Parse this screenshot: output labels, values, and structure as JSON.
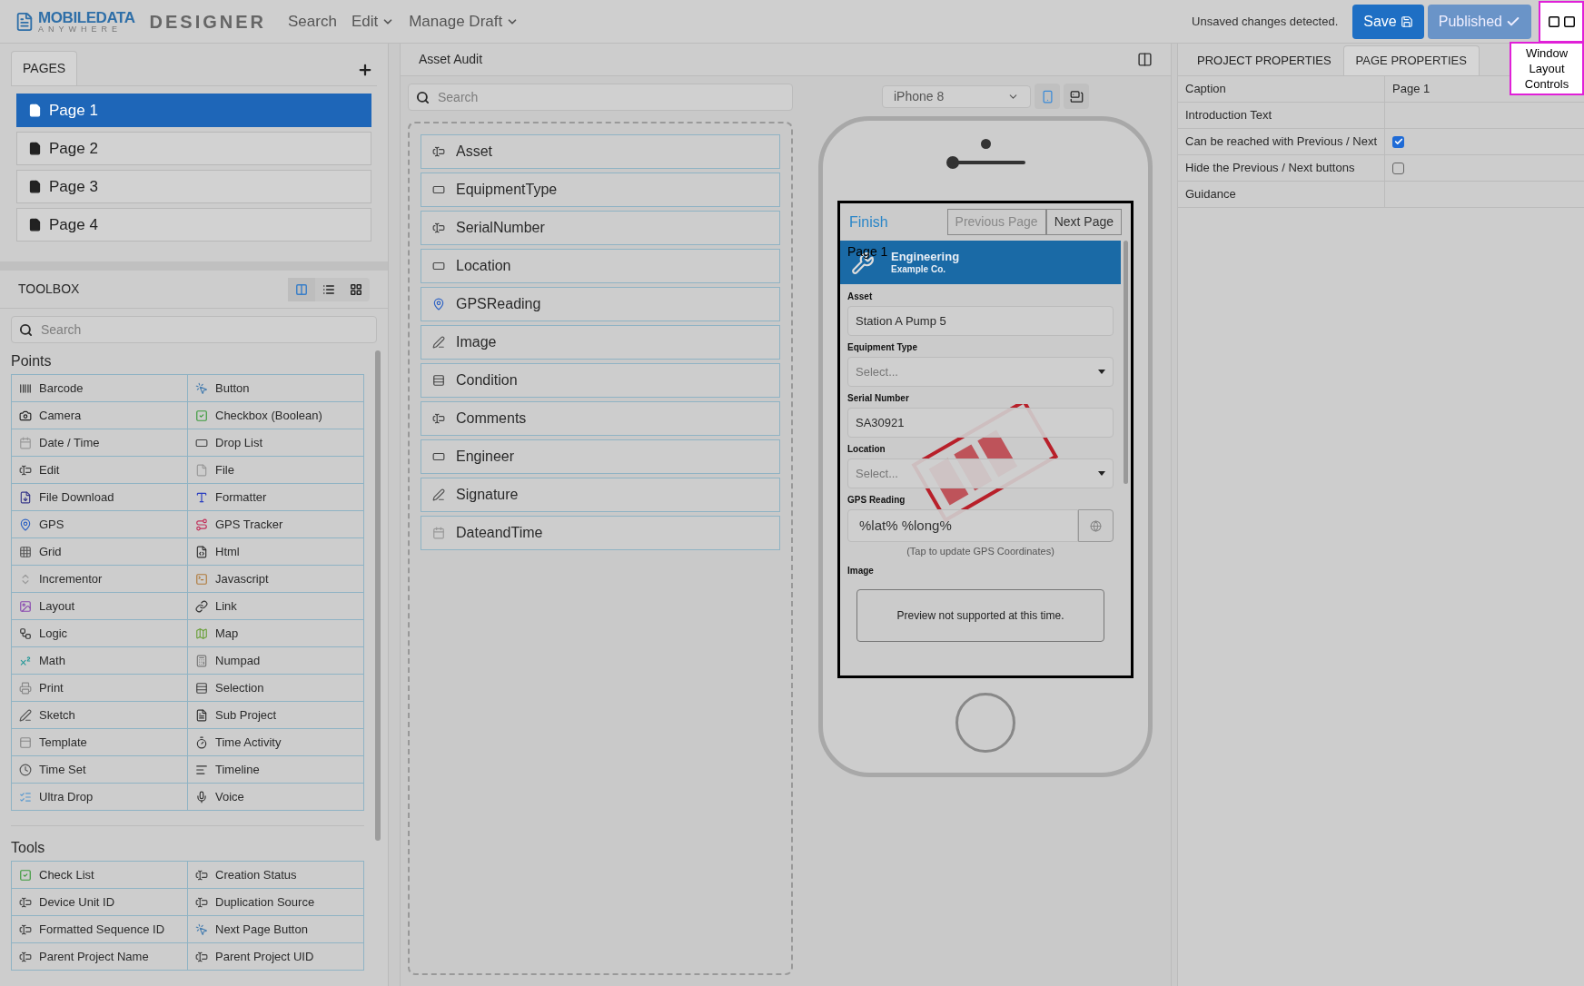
{
  "app": {
    "logo_top": "MOBILEDATA",
    "logo_bottom": "ANYWHERE",
    "title": "DESIGNER"
  },
  "menu": [
    {
      "label": "Search",
      "dropdown": false
    },
    {
      "label": "Edit",
      "dropdown": true
    },
    {
      "label": "Manage Draft",
      "dropdown": true
    }
  ],
  "status": "Unsaved changes detected.",
  "save_button": "Save",
  "publish_button": "Published",
  "layout_tooltip": "Window Layout Controls",
  "pages": {
    "tab": "PAGES",
    "items": [
      {
        "label": "Page 1",
        "selected": true
      },
      {
        "label": "Page 2",
        "selected": false
      },
      {
        "label": "Page 3",
        "selected": false
      },
      {
        "label": "Page 4",
        "selected": false
      }
    ]
  },
  "toolbox": {
    "title": "TOOLBOX",
    "views": [
      {
        "kind": "columns",
        "selected": true
      },
      {
        "kind": "list",
        "selected": false
      },
      {
        "kind": "tiles",
        "selected": false
      }
    ],
    "search_placeholder": "Search",
    "sections": [
      {
        "title": "Points",
        "items": [
          {
            "label": "Barcode",
            "kind": "barcode"
          },
          {
            "label": "Button",
            "kind": "button"
          },
          {
            "label": "Camera",
            "kind": "camera"
          },
          {
            "label": "Checkbox (Boolean)",
            "kind": "check"
          },
          {
            "label": "Date / Time",
            "kind": "date"
          },
          {
            "label": "Drop List",
            "kind": "droplist"
          },
          {
            "label": "Edit",
            "kind": "edit"
          },
          {
            "label": "File",
            "kind": "file"
          },
          {
            "label": "File Download",
            "kind": "download"
          },
          {
            "label": "Formatter",
            "kind": "formatter"
          },
          {
            "label": "GPS",
            "kind": "gps"
          },
          {
            "label": "GPS Tracker",
            "kind": "tracker"
          },
          {
            "label": "Grid",
            "kind": "grid"
          },
          {
            "label": "Html",
            "kind": "html"
          },
          {
            "label": "Incrementor",
            "kind": "incrementor"
          },
          {
            "label": "Javascript",
            "kind": "javascript"
          },
          {
            "label": "Layout",
            "kind": "layout"
          },
          {
            "label": "Link",
            "kind": "link"
          },
          {
            "label": "Logic",
            "kind": "logic"
          },
          {
            "label": "Map",
            "kind": "map"
          },
          {
            "label": "Math",
            "kind": "math"
          },
          {
            "label": "Numpad",
            "kind": "numpad"
          },
          {
            "label": "Print",
            "kind": "print"
          },
          {
            "label": "Selection",
            "kind": "selection"
          },
          {
            "label": "Sketch",
            "kind": "sketch"
          },
          {
            "label": "Sub Project",
            "kind": "subproject"
          },
          {
            "label": "Template",
            "kind": "template"
          },
          {
            "label": "Time Activity",
            "kind": "activity"
          },
          {
            "label": "Time Set",
            "kind": "timeset"
          },
          {
            "label": "Timeline",
            "kind": "timeline"
          },
          {
            "label": "Ultra Drop",
            "kind": "ultradrop"
          },
          {
            "label": "Voice",
            "kind": "voice"
          }
        ]
      },
      {
        "title": "Tools",
        "items": [
          {
            "label": "Check List",
            "kind": "check"
          },
          {
            "label": "Creation Status",
            "kind": "edit"
          },
          {
            "label": "Device Unit ID",
            "kind": "edit"
          },
          {
            "label": "Duplication Source",
            "kind": "edit"
          },
          {
            "label": "Formatted Sequence ID",
            "kind": "edit"
          },
          {
            "label": "Next Page Button",
            "kind": "button"
          },
          {
            "label": "Parent Project Name",
            "kind": "edit"
          },
          {
            "label": "Parent Project UID",
            "kind": "edit"
          }
        ]
      }
    ]
  },
  "designer": {
    "title": "Asset Audit",
    "search_placeholder": "Search",
    "fields": [
      {
        "label": "Asset",
        "kind": "edit"
      },
      {
        "label": "EquipmentType",
        "kind": "droplist"
      },
      {
        "label": "SerialNumber",
        "kind": "edit"
      },
      {
        "label": "Location",
        "kind": "droplist"
      },
      {
        "label": "GPSReading",
        "kind": "gps"
      },
      {
        "label": "Image",
        "kind": "sketch"
      },
      {
        "label": "Condition",
        "kind": "selection"
      },
      {
        "label": "Comments",
        "kind": "edit"
      },
      {
        "label": "Engineer",
        "kind": "droplist"
      },
      {
        "label": "Signature",
        "kind": "sketch"
      },
      {
        "label": "DateandTime",
        "kind": "date"
      }
    ]
  },
  "preview": {
    "device": "iPhone 8",
    "orientations": [
      {
        "kind": "portrait",
        "selected": true
      },
      {
        "kind": "landscape",
        "selected": false
      }
    ],
    "finish": "Finish",
    "nav": [
      {
        "label": "Previous Page",
        "disabled": true
      },
      {
        "label": "Next Page",
        "disabled": false
      }
    ],
    "page_caption": "Page 1",
    "company": "Engineering",
    "company_sub": "Example Co.",
    "form": [
      {
        "label": "Asset",
        "kind": "text",
        "value": "Station A Pump 5"
      },
      {
        "label": "Equipment Type",
        "kind": "select",
        "placeholder": "Select..."
      },
      {
        "label": "Serial Number",
        "kind": "text",
        "value": "SA30921"
      },
      {
        "label": "Location",
        "kind": "select",
        "placeholder": "Select..."
      },
      {
        "label": "GPS Reading",
        "kind": "gps",
        "value": "%lat% %long%",
        "hint": "(Tap to update GPS Coordinates)"
      },
      {
        "label": "Image",
        "kind": "image",
        "note": "Preview not supported at this time."
      }
    ]
  },
  "properties": {
    "tabs": [
      {
        "label": "PROJECT PROPERTIES",
        "selected": false
      },
      {
        "label": "PAGE PROPERTIES",
        "selected": true
      }
    ],
    "rows": [
      {
        "label": "Caption",
        "kind": "text",
        "value": "Page 1"
      },
      {
        "label": "Introduction Text",
        "kind": "text"
      },
      {
        "label": "Can be reached with Previous / Next",
        "kind": "checkbox",
        "checked": true
      },
      {
        "label": "Hide the Previous / Next buttons",
        "kind": "checkbox",
        "checked": false
      },
      {
        "label": "Guidance",
        "kind": "text"
      }
    ]
  }
}
